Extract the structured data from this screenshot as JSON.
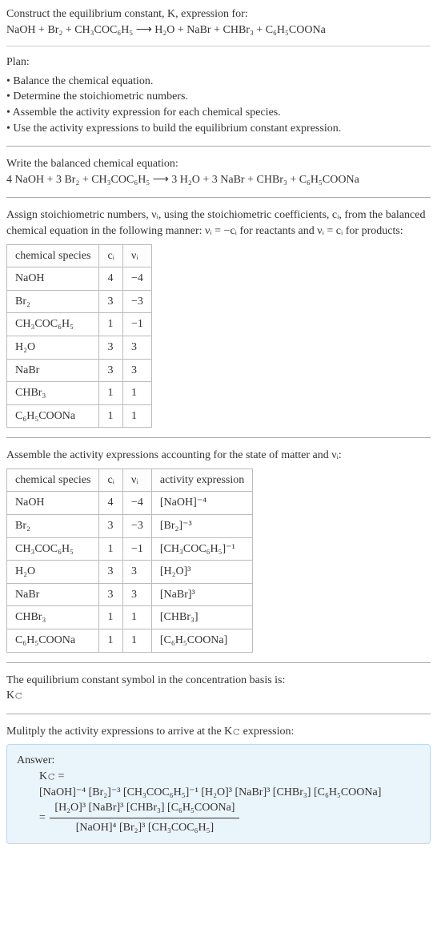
{
  "intro": {
    "line1": "Construct the equilibrium constant, K, expression for:",
    "equation": "NaOH + Br₂ + CH₃COC₆H₅  ⟶  H₂O + NaBr + CHBr₃ + C₆H₅COONa"
  },
  "plan": {
    "heading": "Plan:",
    "items": [
      "Balance the chemical equation.",
      "Determine the stoichiometric numbers.",
      "Assemble the activity expression for each chemical species.",
      "Use the activity expressions to build the equilibrium constant expression."
    ]
  },
  "balanced": {
    "heading": "Write the balanced chemical equation:",
    "equation": "4 NaOH + 3 Br₂ + CH₃COC₆H₅  ⟶  3 H₂O + 3 NaBr + CHBr₃ + C₆H₅COONa"
  },
  "assign": {
    "text": "Assign stoichiometric numbers, νᵢ, using the stoichiometric coefficients, cᵢ, from the balanced chemical equation in the following manner: νᵢ = −cᵢ for reactants and νᵢ = cᵢ for products:"
  },
  "table1": {
    "headers": [
      "chemical species",
      "cᵢ",
      "νᵢ"
    ],
    "rows": [
      [
        "NaOH",
        "4",
        "−4"
      ],
      [
        "Br₂",
        "3",
        "−3"
      ],
      [
        "CH₃COC₆H₅",
        "1",
        "−1"
      ],
      [
        "H₂O",
        "3",
        "3"
      ],
      [
        "NaBr",
        "3",
        "3"
      ],
      [
        "CHBr₃",
        "1",
        "1"
      ],
      [
        "C₆H₅COONa",
        "1",
        "1"
      ]
    ]
  },
  "assemble": "Assemble the activity expressions accounting for the state of matter and νᵢ:",
  "table2": {
    "headers": [
      "chemical species",
      "cᵢ",
      "νᵢ",
      "activity expression"
    ],
    "rows": [
      [
        "NaOH",
        "4",
        "−4",
        "[NaOH]⁻⁴"
      ],
      [
        "Br₂",
        "3",
        "−3",
        "[Br₂]⁻³"
      ],
      [
        "CH₃COC₆H₅",
        "1",
        "−1",
        "[CH₃COC₆H₅]⁻¹"
      ],
      [
        "H₂O",
        "3",
        "3",
        "[H₂O]³"
      ],
      [
        "NaBr",
        "3",
        "3",
        "[NaBr]³"
      ],
      [
        "CHBr₃",
        "1",
        "1",
        "[CHBr₃]"
      ],
      [
        "C₆H₅COONa",
        "1",
        "1",
        "[C₆H₅COONa]"
      ]
    ]
  },
  "eqsymbol": {
    "line1": "The equilibrium constant symbol in the concentration basis is:",
    "line2": "K𝚌"
  },
  "multiply": "Mulitply the activity expressions to arrive at the K𝚌 expression:",
  "answer": {
    "heading": "Answer:",
    "kc": "K𝚌 =",
    "expanded": "[NaOH]⁻⁴ [Br₂]⁻³ [CH₃COC₆H₅]⁻¹ [H₂O]³ [NaBr]³ [CHBr₃] [C₆H₅COONa]",
    "frac_num": "[H₂O]³ [NaBr]³ [CHBr₃] [C₆H₅COONa]",
    "frac_den": "[NaOH]⁴ [Br₂]³ [CH₃COC₆H₅]"
  },
  "chart_data": {
    "type": "table",
    "tables": [
      {
        "title": "Stoichiometric numbers",
        "columns": [
          "chemical species",
          "c_i",
          "nu_i"
        ],
        "rows": [
          {
            "chemical species": "NaOH",
            "c_i": 4,
            "nu_i": -4
          },
          {
            "chemical species": "Br2",
            "c_i": 3,
            "nu_i": -3
          },
          {
            "chemical species": "CH3COC6H5",
            "c_i": 1,
            "nu_i": -1
          },
          {
            "chemical species": "H2O",
            "c_i": 3,
            "nu_i": 3
          },
          {
            "chemical species": "NaBr",
            "c_i": 3,
            "nu_i": 3
          },
          {
            "chemical species": "CHBr3",
            "c_i": 1,
            "nu_i": 1
          },
          {
            "chemical species": "C6H5COONa",
            "c_i": 1,
            "nu_i": 1
          }
        ]
      },
      {
        "title": "Activity expressions",
        "columns": [
          "chemical species",
          "c_i",
          "nu_i",
          "activity expression"
        ],
        "rows": [
          {
            "chemical species": "NaOH",
            "c_i": 4,
            "nu_i": -4,
            "activity expression": "[NaOH]^-4"
          },
          {
            "chemical species": "Br2",
            "c_i": 3,
            "nu_i": -3,
            "activity expression": "[Br2]^-3"
          },
          {
            "chemical species": "CH3COC6H5",
            "c_i": 1,
            "nu_i": -1,
            "activity expression": "[CH3COC6H5]^-1"
          },
          {
            "chemical species": "H2O",
            "c_i": 3,
            "nu_i": 3,
            "activity expression": "[H2O]^3"
          },
          {
            "chemical species": "NaBr",
            "c_i": 3,
            "nu_i": 3,
            "activity expression": "[NaBr]^3"
          },
          {
            "chemical species": "CHBr3",
            "c_i": 1,
            "nu_i": 1,
            "activity expression": "[CHBr3]"
          },
          {
            "chemical species": "C6H5COONa",
            "c_i": 1,
            "nu_i": 1,
            "activity expression": "[C6H5COONa]"
          }
        ]
      }
    ]
  }
}
